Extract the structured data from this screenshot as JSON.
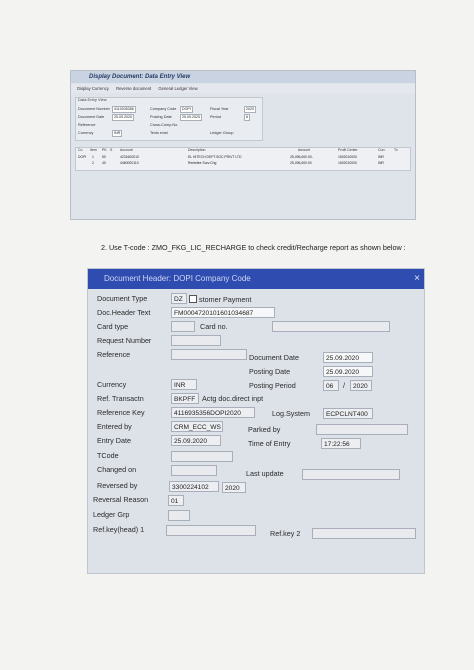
{
  "screen1": {
    "window_title": "Display Document: Data Entry View",
    "toolbar": [
      "Display Currency",
      "General Ledger View",
      "Reverse document"
    ],
    "group_header": "Data Entry View",
    "fields": [
      {
        "label": "Document Number",
        "value": "4110035356"
      },
      {
        "label": "Company Code",
        "value": "DOPI"
      },
      {
        "label": "Fiscal Year",
        "value": "2020"
      },
      {
        "label": "Document Date",
        "value": "25.09.2020"
      },
      {
        "label": "Posting Date",
        "value": "25.09.2020"
      },
      {
        "label": "Period",
        "value": "6"
      },
      {
        "label": "Reference",
        "value": ""
      },
      {
        "label": "Cross-Comp.No.",
        "value": ""
      },
      {
        "label": "Currency",
        "value": "INR"
      },
      {
        "label": "Texts exist",
        "value": ""
      },
      {
        "label": "Ledger Group",
        "value": ""
      }
    ],
    "table_headers": [
      "Co",
      "Item",
      "PK",
      "S",
      "Account",
      "Description",
      "Amount",
      "Profit Center",
      "Curr.",
      "Tx"
    ],
    "rows": [
      [
        "DOPI",
        "1",
        "50",
        "",
        "4231600010",
        "EL HITECH DEPT.SOC.PRIVT LTD",
        "25,496,600.00-",
        "1502010000",
        "INR",
        ""
      ],
      [
        "",
        "2",
        "40",
        "",
        "4460000110",
        "Rentsfee Surv.Chg",
        "25,496,600.00",
        "1502010000",
        "INR",
        ""
      ]
    ]
  },
  "instruction": "2.   Use T-code :  ZMO_FKG_LIC_RECHARGE to check credit/Recharge report as shown below :",
  "screen2": {
    "title": "Document Header: DOPI Company Code",
    "close": "×",
    "labels": {
      "document_type": "Document Type",
      "doc_header_text": "Doc.Header Text",
      "card_type": "Card type",
      "card_no": "Card no.",
      "request_number": "Request Number",
      "reference": "Reference",
      "document_date": "Document Date",
      "posting_date": "Posting Date",
      "currency": "Currency",
      "posting_period": "Posting Period",
      "ref_transactn": "Ref. Transactn",
      "reference_key": "Reference Key",
      "log_system": "Log.System",
      "entered_by": "Entered by",
      "parked_by": "Parked by",
      "entry_date": "Entry Date",
      "time_of_entry": "Time of Entry",
      "tcode": "TCode",
      "changed_on": "Changed on",
      "last_update": "Last update",
      "reversed_by": "Reversed by",
      "reversal_reason": "Reversal Reason",
      "ledger_grp": "Ledger Grp",
      "ref_key_head_1": "Ref.key(head) 1",
      "ref_key_2": "Ref.key 2"
    },
    "values": {
      "document_type_code": "DZ",
      "document_type_text": "stomer Payment",
      "doc_header_text": "FM0004720101601034687",
      "document_date": "25.09.2020",
      "posting_date": "25.09.2020",
      "currency": "INR",
      "posting_period": "06",
      "posting_year": "2020",
      "period_separator": "/",
      "ref_transactn_code": "BKPFF",
      "ref_transactn_text": "Actg doc.direct inpt",
      "reference_key": "4116935356DOPI2020",
      "log_system": "ECPCLNT400",
      "entered_by": "CRM_ECC_WS",
      "entry_date": "25.09.2020",
      "time_of_entry": "17:22:56",
      "reversed_by": "3300224102",
      "reversed_year": "2020",
      "reversal_reason": "01"
    }
  }
}
